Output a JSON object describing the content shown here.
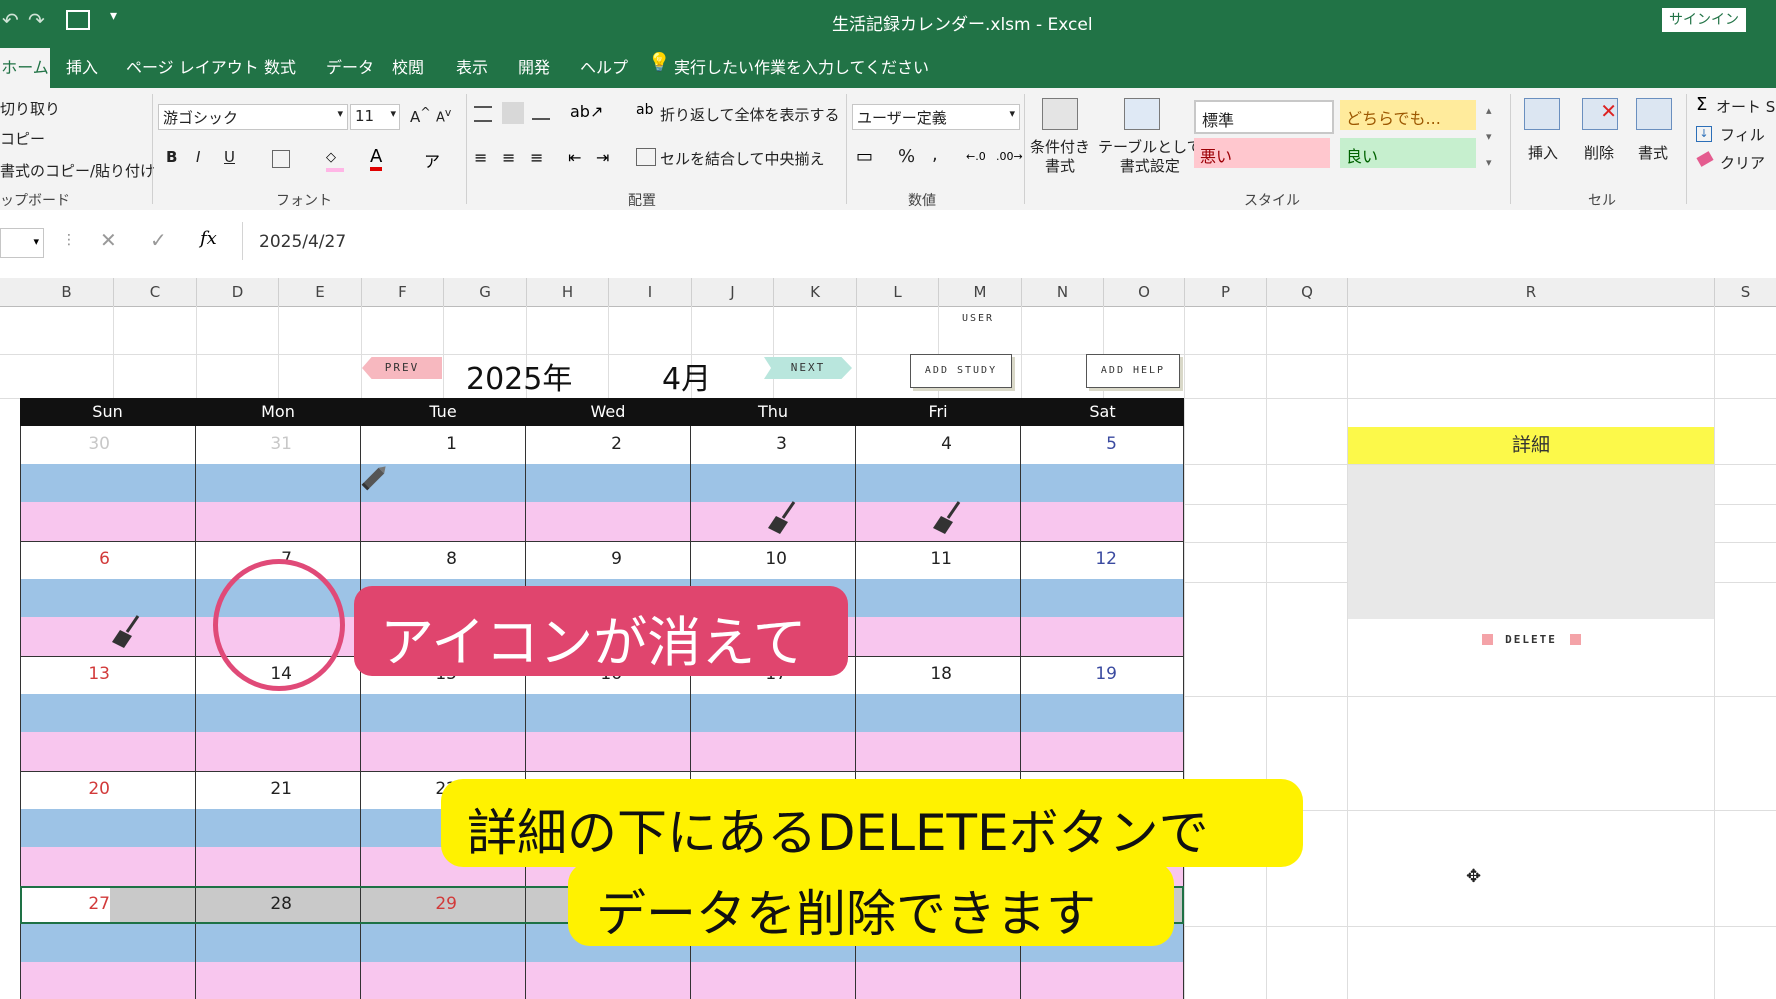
{
  "window": {
    "title": "生活記録カレンダー.xlsm  -  Excel",
    "signin": "サインイン"
  },
  "ribbon_tabs": [
    "ホーム",
    "挿入",
    "ページ レイアウト",
    "数式",
    "データ",
    "校閲",
    "表示",
    "開発",
    "ヘルプ"
  ],
  "tell_me": "実行したい作業を入力してください",
  "clipboard": {
    "cut": "切り取り",
    "copy": "コピー",
    "format_painter": "書式のコピー/貼り付け",
    "group": "ップボード"
  },
  "font": {
    "name": "游ゴシック",
    "size": "11",
    "bold": "B",
    "italic": "I",
    "underline": "U",
    "group": "フォント"
  },
  "alignment": {
    "wrap": "折り返して全体を表示する",
    "merge": "セルを結合して中央揃え",
    "group": "配置"
  },
  "number": {
    "format": "ユーザー定義",
    "percent": "%",
    "comma": ",",
    "group": "数値"
  },
  "styles": {
    "conditional": "条件付き\n書式",
    "table": "テーブルとして\n書式設定",
    "normal": "標準",
    "neutral": "どちらでも...",
    "bad": "悪い",
    "good": "良い",
    "group": "スタイル"
  },
  "cells": {
    "insert": "挿入",
    "delete": "削除",
    "format": "書式",
    "group": "セル"
  },
  "editing": {
    "autosum": "オート SU",
    "fill": "フィル",
    "clear": "クリア"
  },
  "formula_bar": {
    "fx": "fx",
    "value": "2025/4/27"
  },
  "columns": [
    "B",
    "C",
    "D",
    "E",
    "F",
    "G",
    "H",
    "I",
    "J",
    "K",
    "L",
    "M",
    "N",
    "O",
    "P",
    "Q",
    "R",
    "S"
  ],
  "calendar": {
    "prev": "PREV",
    "next": "NEXT",
    "year": "2025年",
    "month": "4月",
    "user": "USER",
    "add_study": "ADD STUDY",
    "add_help": "ADD HELP",
    "days": [
      "Sun",
      "Mon",
      "Tue",
      "Wed",
      "Thu",
      "Fri",
      "Sat"
    ],
    "weeks": [
      [
        "30",
        "31",
        "1",
        "2",
        "3",
        "4",
        "5"
      ],
      [
        "6",
        "7",
        "8",
        "9",
        "10",
        "11",
        "12"
      ],
      [
        "13",
        "14",
        "15",
        "16",
        "17",
        "18",
        "19"
      ],
      [
        "20",
        "21",
        "22",
        "",
        "",
        "",
        ""
      ],
      [
        "27",
        "28",
        "29",
        "",
        "",
        "",
        ""
      ]
    ]
  },
  "detail": {
    "title": "詳細",
    "delete": "DELETE"
  },
  "captions": {
    "pink": "アイコンが消えて",
    "yellow_line1": "詳細の下にあるDELETEボタンで",
    "yellow_line2": "データを削除できます"
  },
  "colors": {
    "excel_green": "#217346",
    "blue_band": "#9dc3e6",
    "pink_band": "#f8c6ee",
    "caption_pink": "#e0456e",
    "caption_yellow": "#fff200"
  }
}
